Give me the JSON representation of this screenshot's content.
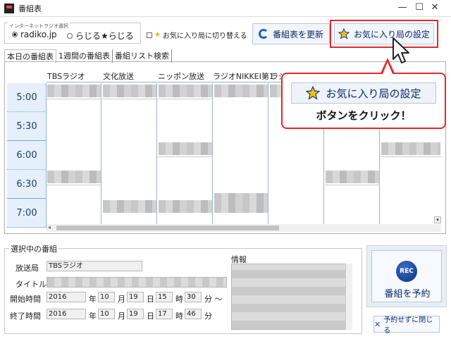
{
  "window": {
    "title": "番組表",
    "minimize": "—",
    "maximize": "☐",
    "close": "✕"
  },
  "radio_group": {
    "label": "インターネットラジオ選択",
    "options": [
      {
        "label": "radiko.jp",
        "selected": true
      },
      {
        "label": "らじる★らじる",
        "selected": false
      }
    ]
  },
  "toolbar": {
    "fav_toggle_label": "お気に入り局に切り替える",
    "refresh_label": "番組表を更新",
    "fav_settings_label": "お気に入り局の設定"
  },
  "tabs": [
    {
      "label": "本日の番組表",
      "active": true
    },
    {
      "label": "1週間の番組表",
      "active": false
    },
    {
      "label": "番組リスト検索",
      "active": false
    }
  ],
  "schedule": {
    "stations": [
      "TBSラジオ",
      "文化放送",
      "ニッポン放送",
      "ラジオNIKKEI第1",
      "ラジ"
    ],
    "times": [
      "5:00",
      "5:30",
      "6:00",
      "6:30",
      "7:00"
    ]
  },
  "callout": {
    "button_label": "お気に入り局の設定",
    "text": "ボタンをクリック！"
  },
  "selected_program": {
    "legend": "選択中の番組",
    "station_label": "放送局",
    "station_value": "TBSラジオ",
    "title_label": "タイトル",
    "start_label": "開始時間",
    "end_label": "終了時間",
    "start": {
      "year": "2016",
      "month": "10",
      "day": "19",
      "hour": "15",
      "minute": "30"
    },
    "end": {
      "year": "2016",
      "month": "10",
      "day": "19",
      "hour": "17",
      "minute": "46"
    },
    "units": {
      "year": "年",
      "month": "月",
      "day": "日",
      "hour": "時",
      "minute": "分",
      "range": "分 ～"
    },
    "info_label": "情報"
  },
  "actions": {
    "rec_icon": "REC",
    "reserve_label": "番組を予約",
    "close_label": "予約せずに閉じる"
  },
  "colors": {
    "accent": "#0a2a6a",
    "highlight": "#e8262a",
    "time_column": "#e6f0fb"
  }
}
